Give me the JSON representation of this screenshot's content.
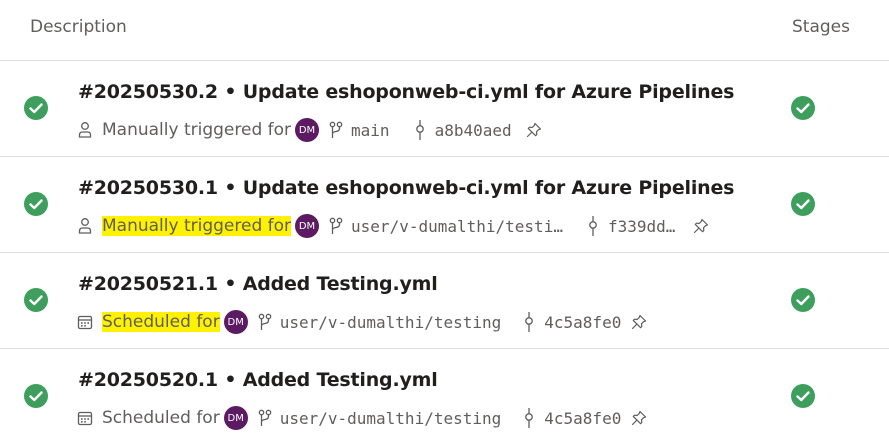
{
  "header": {
    "description": "Description",
    "stages": "Stages"
  },
  "colors": {
    "success": "#3e9e5d",
    "avatar": "#5c1a63",
    "highlight": "#fff200",
    "muted": "#605e5c"
  },
  "runs": [
    {
      "title": "#20250530.2 • Update eshoponweb-ci.yml for Azure Pipelines",
      "trigger_icon": "person-icon",
      "trigger": "Manually triggered for",
      "avatar": "DM",
      "branch": "main",
      "commit": "a8b40aed",
      "status": "succeeded",
      "stage_status": "succeeded"
    },
    {
      "title": "#20250530.1 • Update eshoponweb-ci.yml for Azure Pipelines",
      "trigger_icon": "person-icon",
      "trigger": "Manually triggered for",
      "avatar": "DM",
      "branch": "user/v-dumalthi/testi…",
      "commit": "f339dd…",
      "status": "succeeded",
      "stage_status": "succeeded"
    },
    {
      "title": "#20250521.1 • Added Testing.yml",
      "trigger_icon": "calendar-icon",
      "trigger": "Scheduled for",
      "avatar": "DM",
      "branch": "user/v-dumalthi/testing",
      "commit": "4c5a8fe0",
      "status": "succeeded",
      "stage_status": "succeeded"
    },
    {
      "title": "#20250520.1 • Added Testing.yml",
      "trigger_icon": "calendar-icon",
      "trigger": "Scheduled for",
      "avatar": "DM",
      "branch": "user/v-dumalthi/testing",
      "commit": "4c5a8fe0",
      "status": "succeeded",
      "stage_status": "succeeded"
    }
  ]
}
